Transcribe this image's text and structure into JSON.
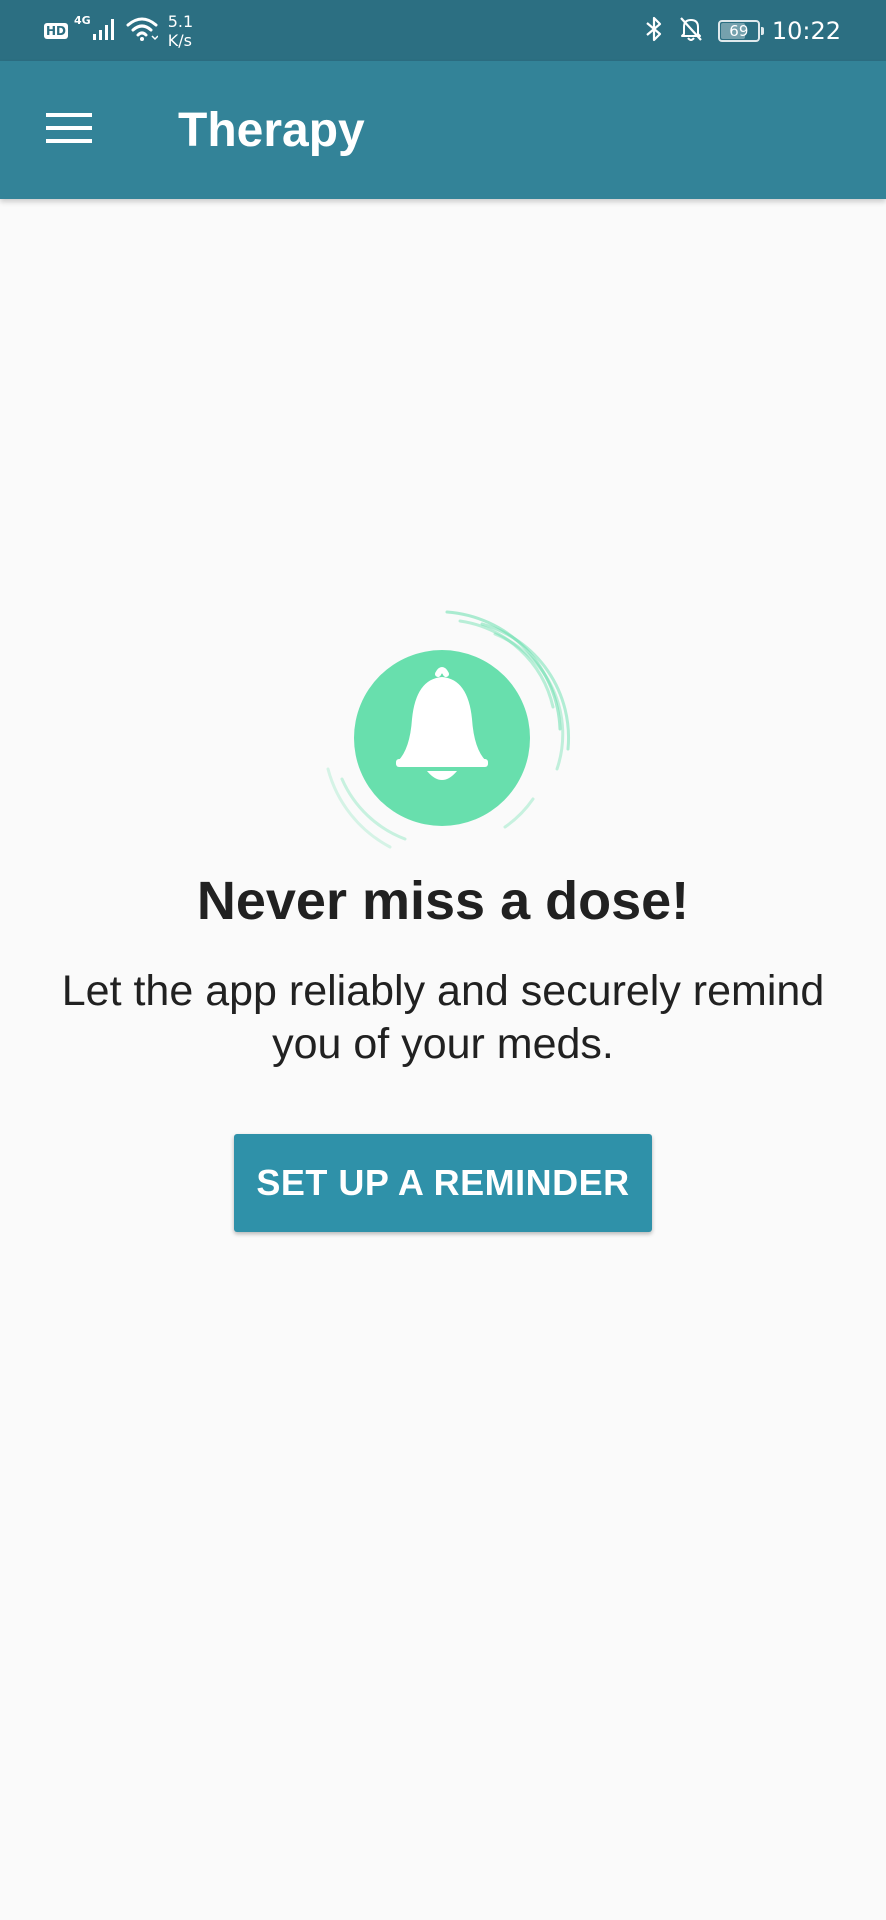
{
  "status_bar": {
    "hd_label": "HD",
    "network_type": "4G",
    "speed_value": "5.1",
    "speed_unit": "K/s",
    "battery_level": "69",
    "battery_fraction": 0.69,
    "time": "10:22",
    "icons": [
      "signal-icon",
      "wifi-icon",
      "bluetooth-icon",
      "bell-off-icon",
      "battery-icon"
    ]
  },
  "app_bar": {
    "menu_icon": "hamburger-menu-icon",
    "title": "Therapy",
    "background_color": "#338398"
  },
  "empty_state": {
    "icon": "bell-icon",
    "icon_color": "#68dfad",
    "headline": "Never miss a dose!",
    "description": "Let the app reliably and securely remind you of your meds.",
    "button_label": "SET UP A REMINDER",
    "button_color": "#2f91a9"
  }
}
